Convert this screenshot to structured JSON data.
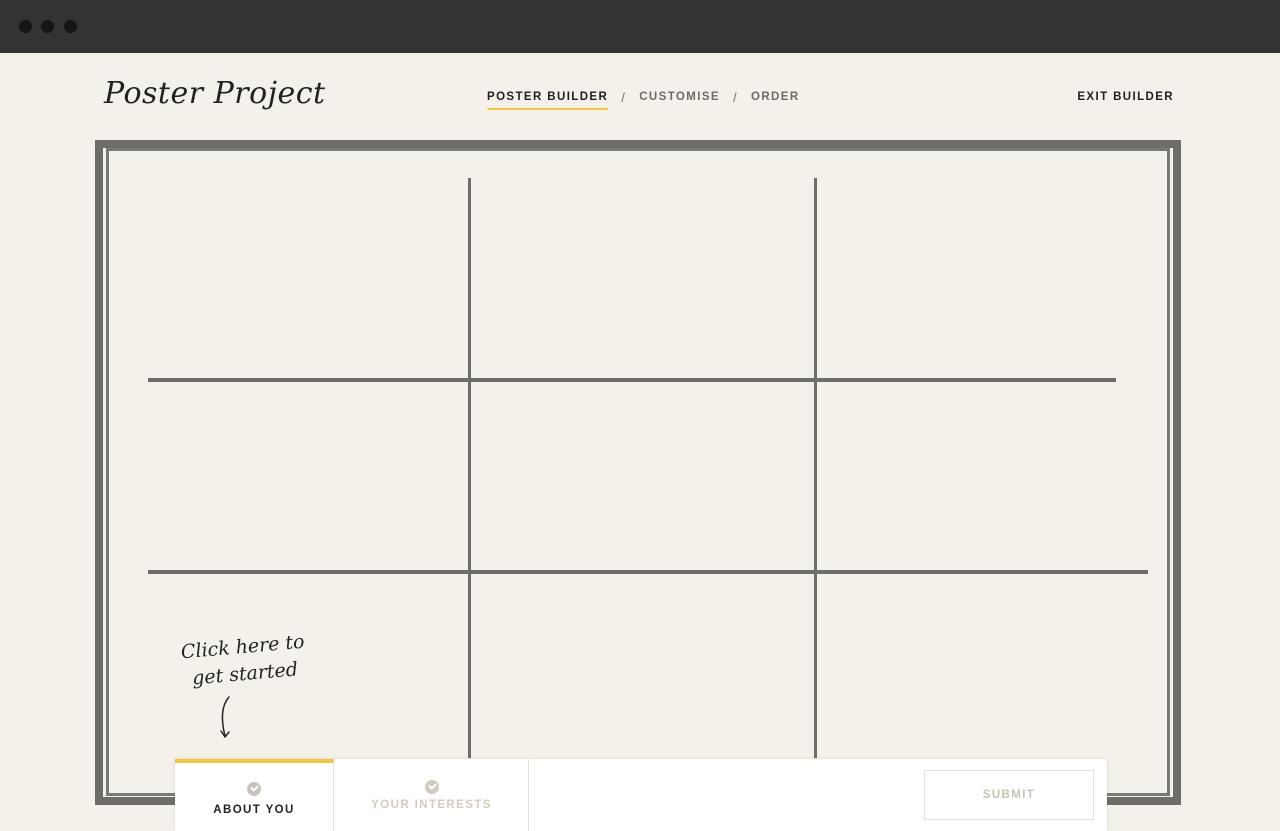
{
  "window": {
    "controls": [
      "close",
      "minimize",
      "maximize"
    ]
  },
  "header": {
    "logo": "Poster Project",
    "steps": [
      {
        "label": "POSTER BUILDER",
        "active": true
      },
      {
        "label": "CUSTOMISE",
        "active": false
      },
      {
        "label": "ORDER",
        "active": false
      }
    ],
    "separator": "/",
    "exit_label": "EXIT BUILDER"
  },
  "poster": {
    "grid": {
      "rows": 3,
      "cols": 3
    },
    "hint_line1": "Click here to",
    "hint_line2": "get started"
  },
  "panel": {
    "tabs": [
      {
        "label": "ABOUT YOU",
        "active": true
      },
      {
        "label": "YOUR INTERESTS",
        "active": false
      }
    ],
    "submit_label": "SUBMIT"
  },
  "colors": {
    "background": "#f4f1ea",
    "titlebar": "#333333",
    "frame": "#6f6d68",
    "accent": "#f2c63a",
    "text": "#1f1f1f"
  }
}
